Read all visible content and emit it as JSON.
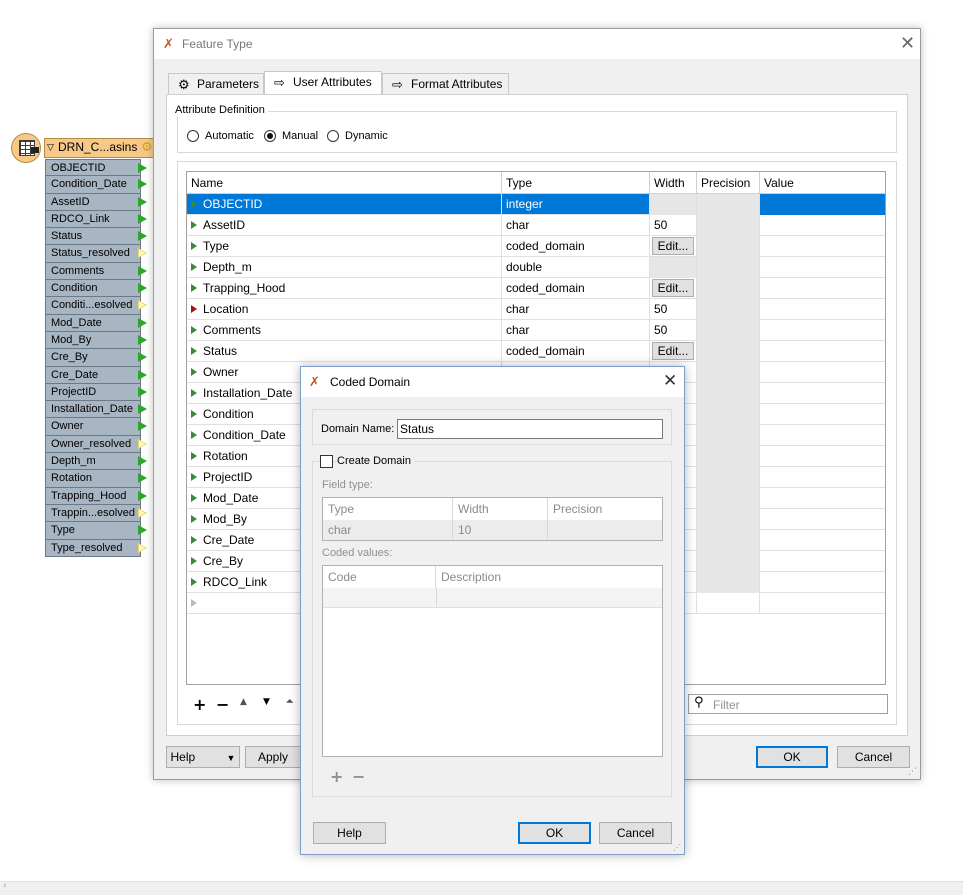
{
  "node": {
    "title": "DRN_C...asins",
    "attributes": [
      {
        "name": "OBJECTID",
        "port": "green"
      },
      {
        "name": "Condition_Date",
        "port": "green"
      },
      {
        "name": "AssetID",
        "port": "green"
      },
      {
        "name": "RDCO_Link",
        "port": "green"
      },
      {
        "name": "Status",
        "port": "green"
      },
      {
        "name": "Status_resolved",
        "port": "yellow"
      },
      {
        "name": "Comments",
        "port": "green"
      },
      {
        "name": "Condition",
        "port": "green"
      },
      {
        "name": "Conditi...esolved",
        "port": "yellow"
      },
      {
        "name": "Mod_Date",
        "port": "green"
      },
      {
        "name": "Mod_By",
        "port": "green"
      },
      {
        "name": "Cre_By",
        "port": "green"
      },
      {
        "name": "Cre_Date",
        "port": "green"
      },
      {
        "name": "ProjectID",
        "port": "green"
      },
      {
        "name": "Installation_Date",
        "port": "green"
      },
      {
        "name": "Owner",
        "port": "green"
      },
      {
        "name": "Owner_resolved",
        "port": "yellow"
      },
      {
        "name": "Depth_m",
        "port": "green"
      },
      {
        "name": "Rotation",
        "port": "green"
      },
      {
        "name": "Trapping_Hood",
        "port": "green"
      },
      {
        "name": "Trappin...esolved",
        "port": "yellow"
      },
      {
        "name": "Type",
        "port": "green"
      },
      {
        "name": "Type_resolved",
        "port": "yellow"
      }
    ]
  },
  "feature_type": {
    "title": "Feature Type",
    "tabs": [
      {
        "label": "Parameters",
        "icon": "gear-icon"
      },
      {
        "label": "User Attributes",
        "icon": "attribute-icon"
      },
      {
        "label": "Format Attributes",
        "icon": "attribute-icon"
      }
    ],
    "attr_definition": {
      "legend": "Attribute Definition",
      "options": [
        "Automatic",
        "Manual",
        "Dynamic"
      ],
      "selected": "Manual"
    },
    "columns": [
      "Name",
      "Type",
      "Width",
      "Precision",
      "Value"
    ],
    "rows": [
      {
        "name": "OBJECTID",
        "type": "integer",
        "width": "",
        "edit": false,
        "selected": true
      },
      {
        "name": "AssetID",
        "type": "char",
        "width": "50",
        "edit": false
      },
      {
        "name": "Type",
        "type": "coded_domain",
        "width": "",
        "edit": true
      },
      {
        "name": "Depth_m",
        "type": "double",
        "width": "",
        "edit": false
      },
      {
        "name": "Trapping_Hood",
        "type": "coded_domain",
        "width": "",
        "edit": true
      },
      {
        "name": "Location",
        "type": "char",
        "width": "50",
        "edit": false,
        "marker": "red"
      },
      {
        "name": "Comments",
        "type": "char",
        "width": "50",
        "edit": false
      },
      {
        "name": "Status",
        "type": "coded_domain",
        "width": "",
        "edit": true
      },
      {
        "name": "Owner",
        "type": "",
        "width": "",
        "edit": false
      },
      {
        "name": "Installation_Date",
        "type": "",
        "width": "",
        "edit": false
      },
      {
        "name": "Condition",
        "type": "",
        "width": "",
        "edit": false
      },
      {
        "name": "Condition_Date",
        "type": "",
        "width": "",
        "edit": false
      },
      {
        "name": "Rotation",
        "type": "",
        "width": "",
        "edit": false
      },
      {
        "name": "ProjectID",
        "type": "",
        "width": "",
        "edit": false
      },
      {
        "name": "Mod_Date",
        "type": "",
        "width": "",
        "edit": false
      },
      {
        "name": "Mod_By",
        "type": "",
        "width": "",
        "edit": false
      },
      {
        "name": "Cre_Date",
        "type": "",
        "width": "",
        "edit": false
      },
      {
        "name": "Cre_By",
        "type": "",
        "width": "",
        "edit": false
      },
      {
        "name": "RDCO_Link",
        "type": "",
        "width": "",
        "edit": false
      }
    ],
    "edit_label": "Edit...",
    "toolbar": [
      "+",
      "−",
      "▲",
      "▼",
      "⏶"
    ],
    "filter_placeholder": "Filter",
    "buttons": {
      "help": "Help",
      "apply": "Apply to...",
      "ok": "OK",
      "cancel": "Cancel"
    }
  },
  "coded_domain": {
    "title": "Coded Domain",
    "domain_name_label": "Domain Name:",
    "domain_name_value": "Status",
    "create_domain_label": "Create Domain",
    "field_type_label": "Field type:",
    "field_type_columns": [
      "Type",
      "Width",
      "Precision"
    ],
    "field_type_row": [
      "char",
      "10",
      ""
    ],
    "coded_values_label": "Coded values:",
    "coded_values_columns": [
      "Code",
      "Description"
    ],
    "add_label": "+",
    "remove_label": "−",
    "buttons": {
      "help": "Help",
      "ok": "OK",
      "cancel": "Cancel"
    }
  },
  "colors": {
    "selection": "#0078d7",
    "node_header": "#f6c987",
    "node_row": "#a8b5c2",
    "port_green": "#2fa52f",
    "port_yellow": "#f0d560"
  }
}
